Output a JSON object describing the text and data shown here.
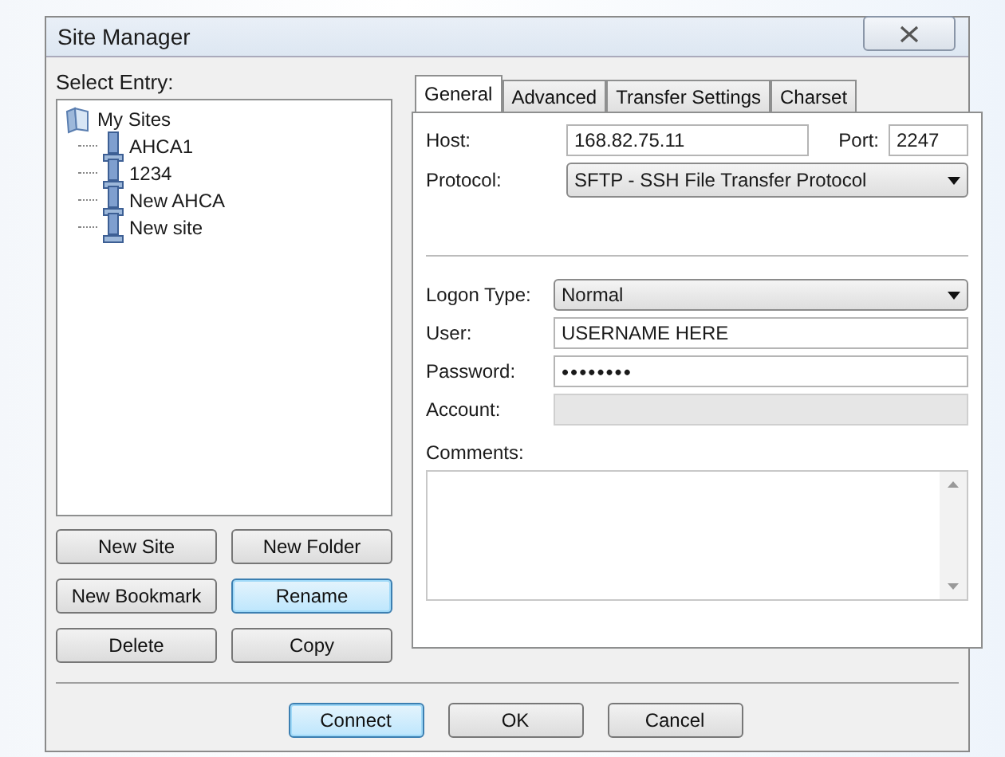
{
  "window": {
    "title": "Site Manager"
  },
  "select_entry": {
    "label": "Select Entry:"
  },
  "tree": [
    {
      "label": "My Sites",
      "kind": "folder",
      "children": [
        {
          "label": "AHCA1",
          "kind": "server"
        },
        {
          "label": "1234",
          "kind": "server"
        },
        {
          "label": "New AHCA",
          "kind": "server"
        },
        {
          "label": "New site",
          "kind": "server"
        }
      ]
    }
  ],
  "tree_buttons": [
    {
      "label": "New Site",
      "focused": false
    },
    {
      "label": "New Folder",
      "focused": false
    },
    {
      "label": "New Bookmark",
      "focused": false
    },
    {
      "label": "Rename",
      "focused": true
    },
    {
      "label": "Delete",
      "focused": false
    },
    {
      "label": "Copy",
      "focused": false
    }
  ],
  "tabs": [
    {
      "label": "General",
      "selected": true
    },
    {
      "label": "Advanced",
      "selected": false
    },
    {
      "label": "Transfer Settings",
      "selected": false
    },
    {
      "label": "Charset",
      "selected": false
    }
  ],
  "host": {
    "label": "Host:",
    "value": "168.82.75.11"
  },
  "port": {
    "label": "Port:",
    "value": "2247"
  },
  "protocol": {
    "label": "Protocol:",
    "value": "SFTP - SSH File Transfer Protocol"
  },
  "fields": [
    {
      "label": "Logon Type:",
      "kind": "dropdown",
      "value": "Normal",
      "disabled": false
    },
    {
      "label": "User:",
      "kind": "text",
      "value": "USERNAME HERE",
      "disabled": false
    },
    {
      "label": "Password:",
      "kind": "password",
      "value": "••••••••",
      "disabled": false
    },
    {
      "label": "Account:",
      "kind": "text",
      "disabled": true
    }
  ],
  "comments": {
    "label": "Comments:"
  },
  "buttons": [
    {
      "label": "Connect",
      "focused": true
    },
    {
      "label": "OK",
      "focused": false
    },
    {
      "label": "Cancel",
      "focused": false
    }
  ]
}
